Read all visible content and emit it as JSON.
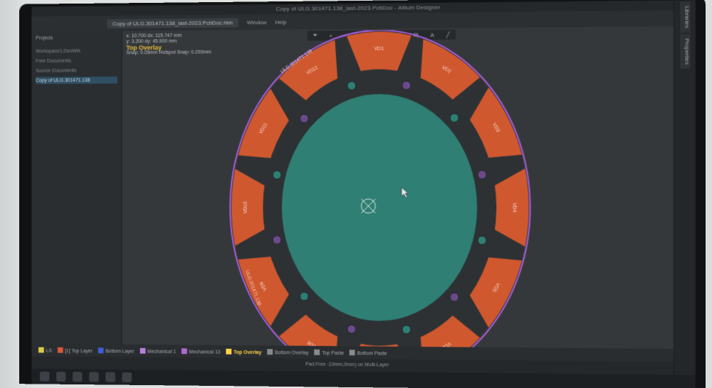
{
  "window": {
    "title": "Copy of ULG.301471.138_last-2023.PcbDoc - Altium Designer"
  },
  "menu": {
    "items": [
      "Window",
      "Help"
    ],
    "doc_tab": "Copy of ULG.301471.138_last-2023.PcbDoc.htm"
  },
  "left_panel": {
    "title": "Projects",
    "tree": [
      "Workspace1.DsnWrk",
      "Free Documents",
      "Source Documents",
      "Copy of ULG.301471.138"
    ]
  },
  "coords": {
    "x": "x: 10.700  dx: 115.747 mm",
    "y": "y: 3.200   dy: 45.900 mm",
    "layer": "Top Overlay",
    "snap": "Snap: 0.05mm  Hotspot Snap: 0.200mm"
  },
  "toolbar": {
    "icons": [
      "filter-icon",
      "plus-icon",
      "rect-icon",
      "route-icon",
      "via-icon",
      "pad-icon",
      "chart-icon",
      "text-icon",
      "line-icon"
    ]
  },
  "right_strip": {
    "tabs": [
      "Libraries",
      "Properties"
    ]
  },
  "layers": {
    "items": [
      {
        "name": "LS",
        "color": "#d8c94a"
      },
      {
        "name": "[1] Top Layer",
        "color": "#d8573a"
      },
      {
        "name": "Bottom Layer",
        "color": "#3c5fd4"
      },
      {
        "name": "Mechanical 1",
        "color": "#b87fe0"
      },
      {
        "name": "Mechanical 13",
        "color": "#b06ad0"
      },
      {
        "name": "Top Overlay",
        "color": "#ffd24a",
        "active": true
      },
      {
        "name": "Bottom Overlay",
        "color": "#8a8a8a"
      },
      {
        "name": "Top Paste",
        "color": "#8a8a8a"
      },
      {
        "name": "Bottom Paste",
        "color": "#8a8a8a"
      }
    ]
  },
  "status": {
    "text": "Pad Free -10mm,0mm) on Multi-Layer"
  },
  "pcb": {
    "board_color": "#d0582f",
    "center_color": "#2f7f74",
    "outline_color": "#a860e0",
    "gap_color": "#2d3134",
    "pad_labels": [
      "VD1",
      "VD2",
      "VD3",
      "VD4",
      "VD5",
      "VD6",
      "VD7",
      "VD8",
      "VD9",
      "VD10",
      "VD11",
      "VD12"
    ],
    "board_text": [
      "ULG.301471.138",
      "ULG.301471.138"
    ]
  }
}
